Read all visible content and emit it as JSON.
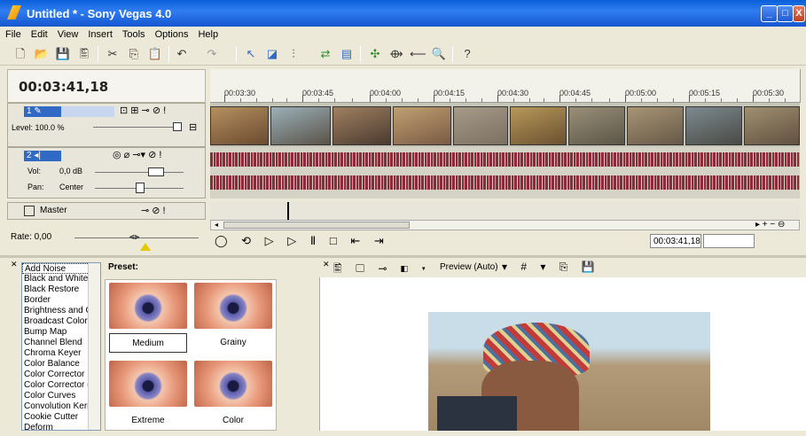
{
  "window": {
    "title": "Untitled * - Sony Vegas 4.0",
    "min": "_",
    "max": "□",
    "close": "X"
  },
  "menu": [
    "File",
    "Edit",
    "View",
    "Insert",
    "Tools",
    "Options",
    "Help"
  ],
  "timecode": "00:03:41,18",
  "ruler": [
    "00:03:30",
    "00:03:45",
    "00:04:00",
    "00:04:15",
    "00:04:30",
    "00:04:45",
    "00:05:00",
    "00:05:15",
    "00:05:30"
  ],
  "video_track": {
    "number": "1",
    "level": "Level: 100.0 %"
  },
  "audio_track": {
    "number": "2",
    "vol_label": "Vol:",
    "vol_value": "0,0 dB",
    "pan_label": "Pan:",
    "pan_value": "Center"
  },
  "master": {
    "label": "Master"
  },
  "rate": "Rate: 0,00",
  "transport_time": "00:03:41,18",
  "fx_list": [
    "Add Noise",
    "Black and White",
    "Black Restore",
    "Border",
    "Brightness and C",
    "Broadcast Colors",
    "Bump Map",
    "Channel Blend",
    "Chroma Keyer",
    "Color Balance",
    "Color Corrector",
    "Color Corrector (S",
    "Color Curves",
    "Convolution Kern",
    "Cookie Cutter",
    "Deform"
  ],
  "preset": {
    "title": "Preset:",
    "items": [
      "Medium",
      "Grainy",
      "Extreme",
      "Color"
    ]
  },
  "preview": {
    "mode": "Preview (Auto)"
  },
  "colors": {
    "accent": "#316ac5",
    "waveform": "#8b2c3a",
    "titlebar": "#0a5fd8"
  }
}
